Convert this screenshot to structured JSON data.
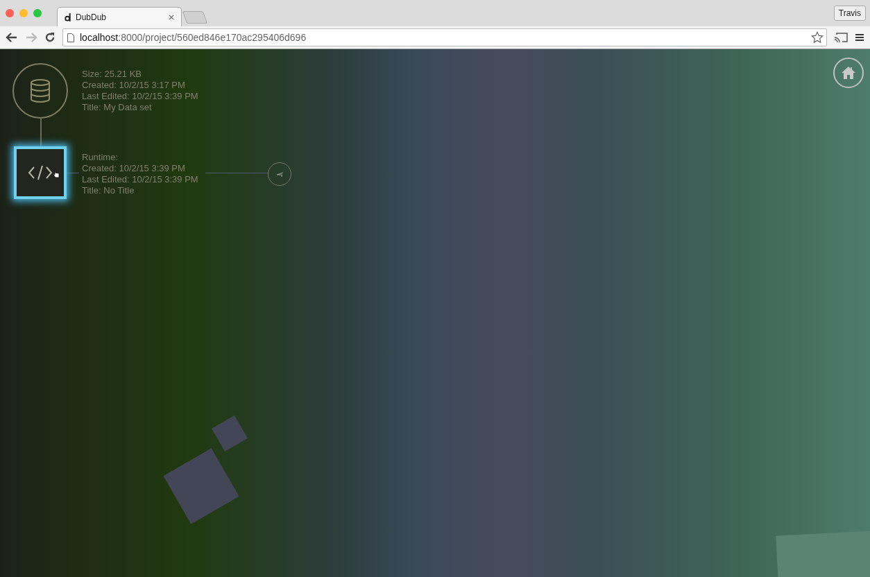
{
  "browser": {
    "tab": {
      "title": "DubDub",
      "selected": true
    },
    "url": {
      "host": "localhost",
      "path": ":8000/project/560ed846e170ac295406d696"
    },
    "profile": "Travis"
  },
  "nodes": [
    {
      "kind": "dataset",
      "selected": false,
      "info": [
        "Size: 25.21 KB",
        "Created: 10/2/15 3:17 PM",
        "Last Edited: 10/2/15 3:39 PM",
        "Title: My Data set"
      ]
    },
    {
      "kind": "script",
      "selected": true,
      "info": [
        "Runtime:",
        "Created: 10/2/15 3:39 PM",
        "Last Edited: 10/2/15 3:39 PM",
        "Title: No Title"
      ]
    }
  ]
}
